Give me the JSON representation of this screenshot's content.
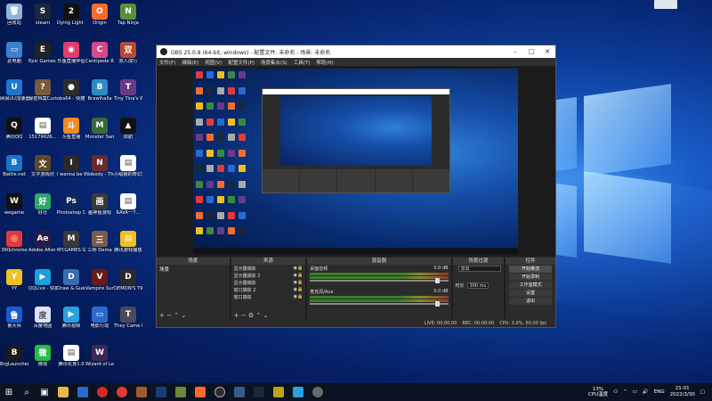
{
  "desktop": {
    "icons": [
      {
        "label": "回收站",
        "color": "#8fb4d9",
        "glyph": "🗑"
      },
      {
        "label": "steam",
        "color": "#1b2838",
        "glyph": "S"
      },
      {
        "label": "Dying Light 2",
        "color": "#111111",
        "glyph": "2"
      },
      {
        "label": "Origin",
        "color": "#f56c2d",
        "glyph": "O"
      },
      {
        "label": "Tap Ninja",
        "color": "#5a8f3a",
        "glyph": "N"
      },
      {
        "label": "此电脑",
        "color": "#3d7fd1",
        "glyph": "▭"
      },
      {
        "label": "Epic Games Launcher",
        "color": "#222222",
        "glyph": "E"
      },
      {
        "label": "乐鱼直播伴侣",
        "color": "#e23a6d",
        "glyph": "◉"
      },
      {
        "label": "Centipede Recharged",
        "color": "#d44a8a",
        "glyph": "C"
      },
      {
        "label": "双人成行",
        "color": "#b7492f",
        "glyph": "双"
      },
      {
        "label": "网易UU加速器",
        "color": "#1e76d2",
        "glyph": "U"
      },
      {
        "label": "解密档案Curious Ex...",
        "color": "#7a5a3a",
        "glyph": "?"
      },
      {
        "label": "obs64 - 快捷方式",
        "color": "#2d2d2d",
        "glyph": "●"
      },
      {
        "label": "Brawlhalla",
        "color": "#2a8cc7",
        "glyph": "B"
      },
      {
        "label": "Tiny Tina's Wonderla...",
        "color": "#6a3a8a",
        "glyph": "T"
      },
      {
        "label": "腾讯QQ",
        "color": "#111111",
        "glyph": "Q"
      },
      {
        "label": "15179026...",
        "color": "#ffffff",
        "glyph": "▤"
      },
      {
        "label": "斗鱼直播",
        "color": "#f08a1e",
        "glyph": "斗"
      },
      {
        "label": "Monster Sanctuary",
        "color": "#3a6a3a",
        "glyph": "M"
      },
      {
        "label": "启航",
        "color": "#111111",
        "glyph": "▲"
      },
      {
        "label": "Battle.net",
        "color": "#1a74c8",
        "glyph": "B"
      },
      {
        "label": "文字游戏坊",
        "color": "#5a4a2a",
        "glyph": "文"
      },
      {
        "label": "I wanna be the Creator",
        "color": "#2a2a2a",
        "glyph": "I"
      },
      {
        "label": "Nobody - The Turnaro...",
        "color": "#6a2a2a",
        "glyph": "N"
      },
      {
        "label": "小缇娜的奇幻之地",
        "color": "#ffffff",
        "glyph": "▤"
      },
      {
        "label": "wegame",
        "color": "#111111",
        "glyph": "W"
      },
      {
        "label": "好迁",
        "color": "#2aa86a",
        "glyph": "好"
      },
      {
        "label": "Photoshop CS6",
        "color": "#0a2a5a",
        "glyph": "Ps"
      },
      {
        "label": "画神鱼游戏",
        "color": "#3a3a3a",
        "glyph": "画"
      },
      {
        "label": "6AVA一7...",
        "color": "#ffffff",
        "glyph": "▤"
      },
      {
        "label": "360chrome",
        "color": "#e23a3a",
        "glyph": "◎"
      },
      {
        "label": "Adobe After Effects CC",
        "color": "#2a1a4a",
        "glyph": "Ae"
      },
      {
        "label": "MY.GAMES GameCenter",
        "color": "#3a3a3a",
        "glyph": "M"
      },
      {
        "label": "三桥 Dema",
        "color": "#7a5a4a",
        "glyph": "三"
      },
      {
        "label": "腾讯游戏播放",
        "color": "#f0c020",
        "glyph": "▤"
      },
      {
        "label": "YY",
        "color": "#f0c020",
        "glyph": "Y"
      },
      {
        "label": "QQLive - 快捷方式",
        "color": "#1aa0e0",
        "glyph": "▶"
      },
      {
        "label": "Draw & Guess",
        "color": "#3a6ab0",
        "glyph": "D"
      },
      {
        "label": "Vampire Survivors",
        "color": "#6a1a1a",
        "glyph": "V"
      },
      {
        "label": "DEMON'S TILT",
        "color": "#2a2a2a",
        "glyph": "D"
      },
      {
        "label": "鲁大师",
        "color": "#1a5ad0",
        "glyph": "鲁"
      },
      {
        "label": "百度地图",
        "color": "#e0e0ff",
        "glyph": "度"
      },
      {
        "label": "腾讯视频",
        "color": "#2aa0e0",
        "glyph": "▶"
      },
      {
        "label": "电影行动",
        "color": "#2a6ad0",
        "glyph": "▭"
      },
      {
        "label": "They Came From Above",
        "color": "#4a4a5a",
        "glyph": "T"
      },
      {
        "label": "BrgLauncher...",
        "color": "#1a1a1a",
        "glyph": "B"
      },
      {
        "label": "微信",
        "color": "#2aba4a",
        "glyph": "微"
      },
      {
        "label": "腾讯化身1.0",
        "color": "#ffffff",
        "glyph": "▤"
      },
      {
        "label": "Wizard of Legend",
        "color": "#3a2a5a",
        "glyph": "W"
      }
    ]
  },
  "obs": {
    "title": "OBS 25.0.8 (64-bit, windows) - 配置文件: 未命名 - 场景: 未命名",
    "menu": [
      "文件(F)",
      "编辑(E)",
      "视图(V)",
      "配置文件(P)",
      "场景集合(S)",
      "工具(T)",
      "帮助(H)"
    ],
    "docks": {
      "scenes": {
        "title": "场景",
        "items": [
          "场景"
        ]
      },
      "sources": {
        "title": "来源",
        "items": [
          "显示器捕获",
          "显示器捕获 2",
          "显示器捕获",
          "窗口捕获 2",
          "窗口捕获"
        ]
      },
      "mixer": {
        "title": "混音器",
        "channels": [
          {
            "name": "桌面音频",
            "db": "0.0 dB"
          },
          {
            "name": "麦克风/Aux",
            "db": "0.0 dB"
          }
        ]
      },
      "transitions": {
        "title": "场景过渡",
        "type": "淡出",
        "duration_label": "时长",
        "duration": "300 ms"
      },
      "controls": {
        "title": "控件",
        "buttons": [
          "开始推流",
          "开始录制",
          "工作室模式",
          "设置",
          "退出"
        ]
      }
    },
    "status": {
      "live": "LIVE: 00:00:00",
      "rec": "REC: 00:00:00",
      "cpu": "CPU: 3.0%, 60.00 fps"
    }
  },
  "taskbar": {
    "cpu_percent": "13%",
    "cpu_label": "CPU温度",
    "lang": "ENG",
    "time": "21:01",
    "date": "2022/3/30"
  },
  "colors": {
    "obs_bg": "#2b2b2b",
    "taskbar": "#0b1322"
  }
}
